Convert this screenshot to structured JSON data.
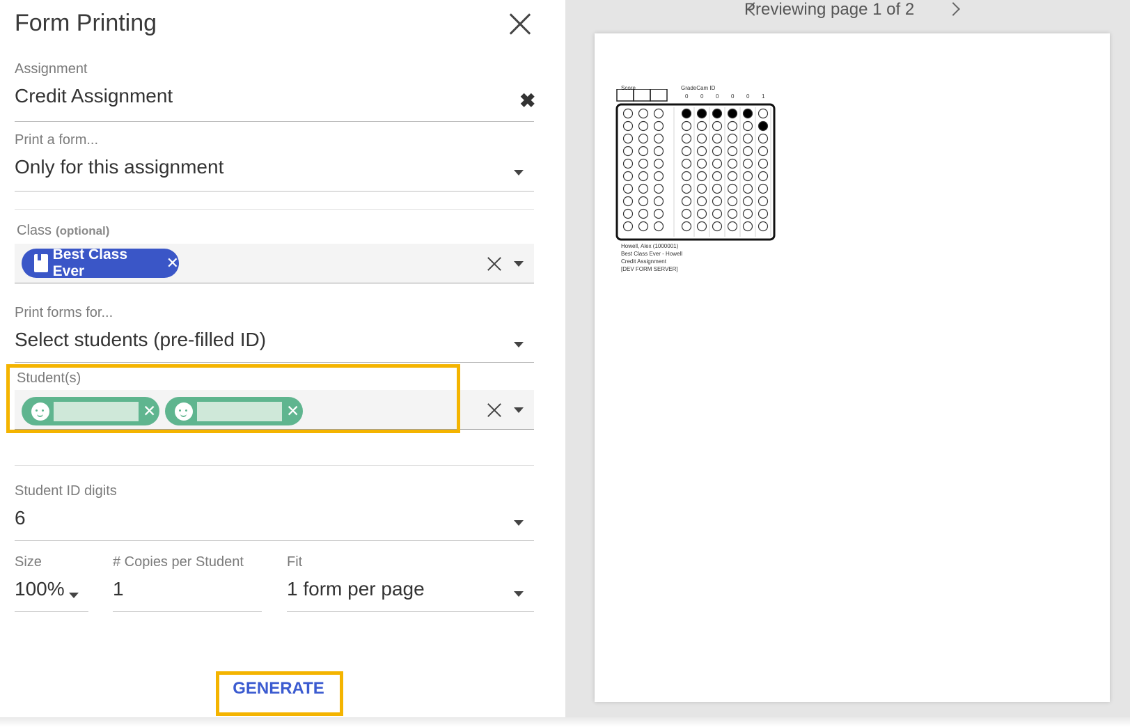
{
  "dialog": {
    "title": "Form Printing"
  },
  "assignment": {
    "label": "Assignment",
    "value": "Credit Assignment"
  },
  "print_form": {
    "label": "Print a form...",
    "value": "Only for this assignment"
  },
  "class_field": {
    "label": "Class",
    "optional": "(optional)",
    "chip": "Best Class Ever"
  },
  "print_for": {
    "label": "Print forms for...",
    "value": "Select students (pre-filled ID)"
  },
  "students": {
    "label": "Student(s)",
    "chips": [
      "",
      ""
    ]
  },
  "id_digits": {
    "label": "Student ID digits",
    "value": "6"
  },
  "size": {
    "label": "Size",
    "value": "100%"
  },
  "copies": {
    "label": "# Copies per Student",
    "value": "1"
  },
  "fit": {
    "label": "Fit",
    "value": "1 form per page"
  },
  "actions": {
    "generate": "GENERATE"
  },
  "preview": {
    "pager_text": "Previewing page 1 of 2",
    "score_label": "Score",
    "gradecam_label": "GradeCam ID",
    "id_digits": [
      "0",
      "0",
      "0",
      "0",
      "0",
      "1"
    ],
    "footer_lines": [
      "Howell, Alex (1000001)",
      "Best Class Ever - Howell",
      "Credit Assignment",
      "[DEV FORM SERVER]"
    ]
  },
  "colors": {
    "chip_blue": "#3a56c7",
    "chip_green": "#5fb58f",
    "highlight": "#f4b400",
    "generate_text": "#3b5bd0"
  }
}
